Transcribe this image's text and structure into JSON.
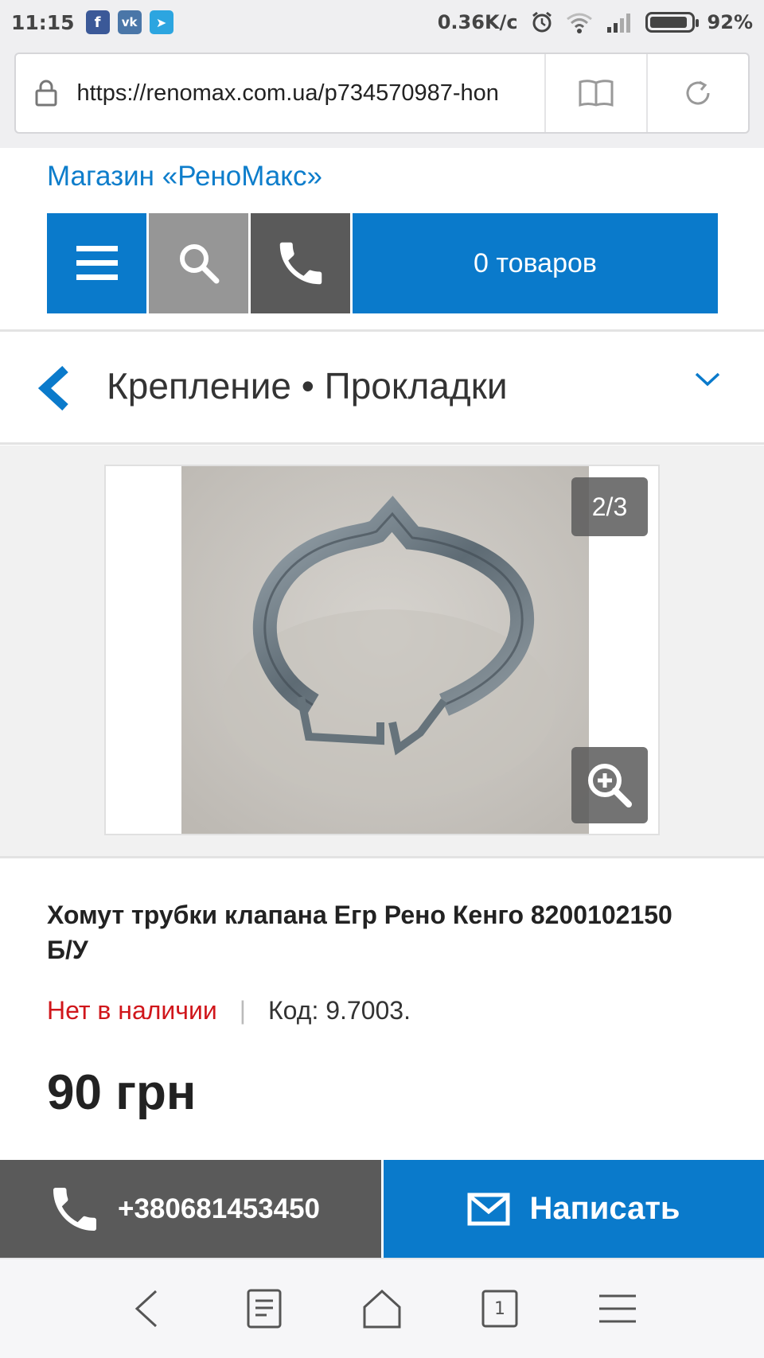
{
  "status_bar": {
    "time": "11:15",
    "apps": [
      {
        "icon": "facebook-icon",
        "glyph": "f",
        "color": "#3b5998"
      },
      {
        "icon": "vk-icon",
        "glyph": "vk",
        "color": "#4a76a8"
      },
      {
        "icon": "telegram-icon",
        "glyph": "➤",
        "color": "#2ca5e0"
      }
    ],
    "network_speed": "0.36K/c",
    "battery_percent": "92%",
    "battery_level": 0.92
  },
  "browser": {
    "url": "https://renomax.com.ua/p734570987-hon"
  },
  "store": {
    "name": "Магазин «РеноМакс»",
    "cart_label": "0 товаров"
  },
  "category": {
    "title": "Крепление • Прокладки"
  },
  "gallery": {
    "counter": "2/3"
  },
  "product": {
    "title": "Хомут трубки клапана Егр Рено Кенго 8200102150 Б/У",
    "availability": "Нет в наличии",
    "separator": "|",
    "code": "Код: 9.7003.",
    "price": "90 грн"
  },
  "actions": {
    "phone": "+380681453450",
    "write": "Написать"
  },
  "browser_nav": {
    "tabs_count": "1"
  },
  "colors": {
    "brand_blue": "#0a7acb",
    "link_blue": "#0d7dcb",
    "dark_gray": "#5a5a5a",
    "mid_gray": "#969696",
    "out_of_stock_red": "#d0161b"
  }
}
